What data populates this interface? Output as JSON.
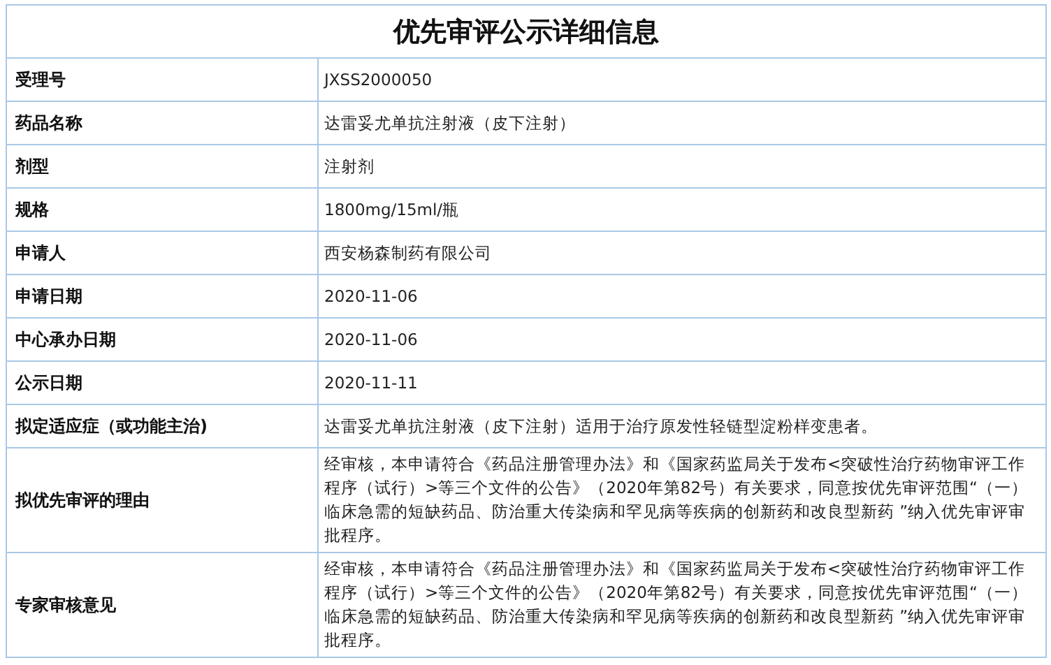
{
  "title": "优先审评公示详细信息",
  "rows": [
    {
      "label": "受理号",
      "value": "JXSS2000050"
    },
    {
      "label": "药品名称",
      "value": "达雷妥尤单抗注射液（皮下注射）"
    },
    {
      "label": "剂型",
      "value": "注射剂"
    },
    {
      "label": "规格",
      "value": "1800mg/15ml/瓶"
    },
    {
      "label": "申请人",
      "value": "西安杨森制药有限公司"
    },
    {
      "label": "申请日期",
      "value": "2020-11-06"
    },
    {
      "label": "中心承办日期",
      "value": "2020-11-06"
    },
    {
      "label": "公示日期",
      "value": "2020-11-11"
    },
    {
      "label": "拟定适应症（或功能主治)",
      "value": "达雷妥尤单抗注射液（皮下注射）适用于治疗原发性轻链型淀粉样变患者。"
    },
    {
      "label": "拟优先审评的理由",
      "value": "经审核，本申请符合《药品注册管理办法》和《国家药监局关于发布<突破性治疗药物审评工作程序（试行）>等三个文件的公告》（2020年第82号）有关要求，同意按优先审评范围“（一）临床急需的短缺药品、防治重大传染病和罕见病等疾病的创新药和改良型新药 ”纳入优先审评审批程序。"
    },
    {
      "label": "专家审核意见",
      "value": "经审核，本申请符合《药品注册管理办法》和《国家药监局关于发布<突破性治疗药物审评工作程序（试行）>等三个文件的公告》（2020年第82号）有关要求，同意按优先审评范围“（一）临床急需的短缺药品、防治重大传染病和罕见病等疾病的创新药和改良型新药 ”纳入优先审评审批程序。"
    }
  ]
}
